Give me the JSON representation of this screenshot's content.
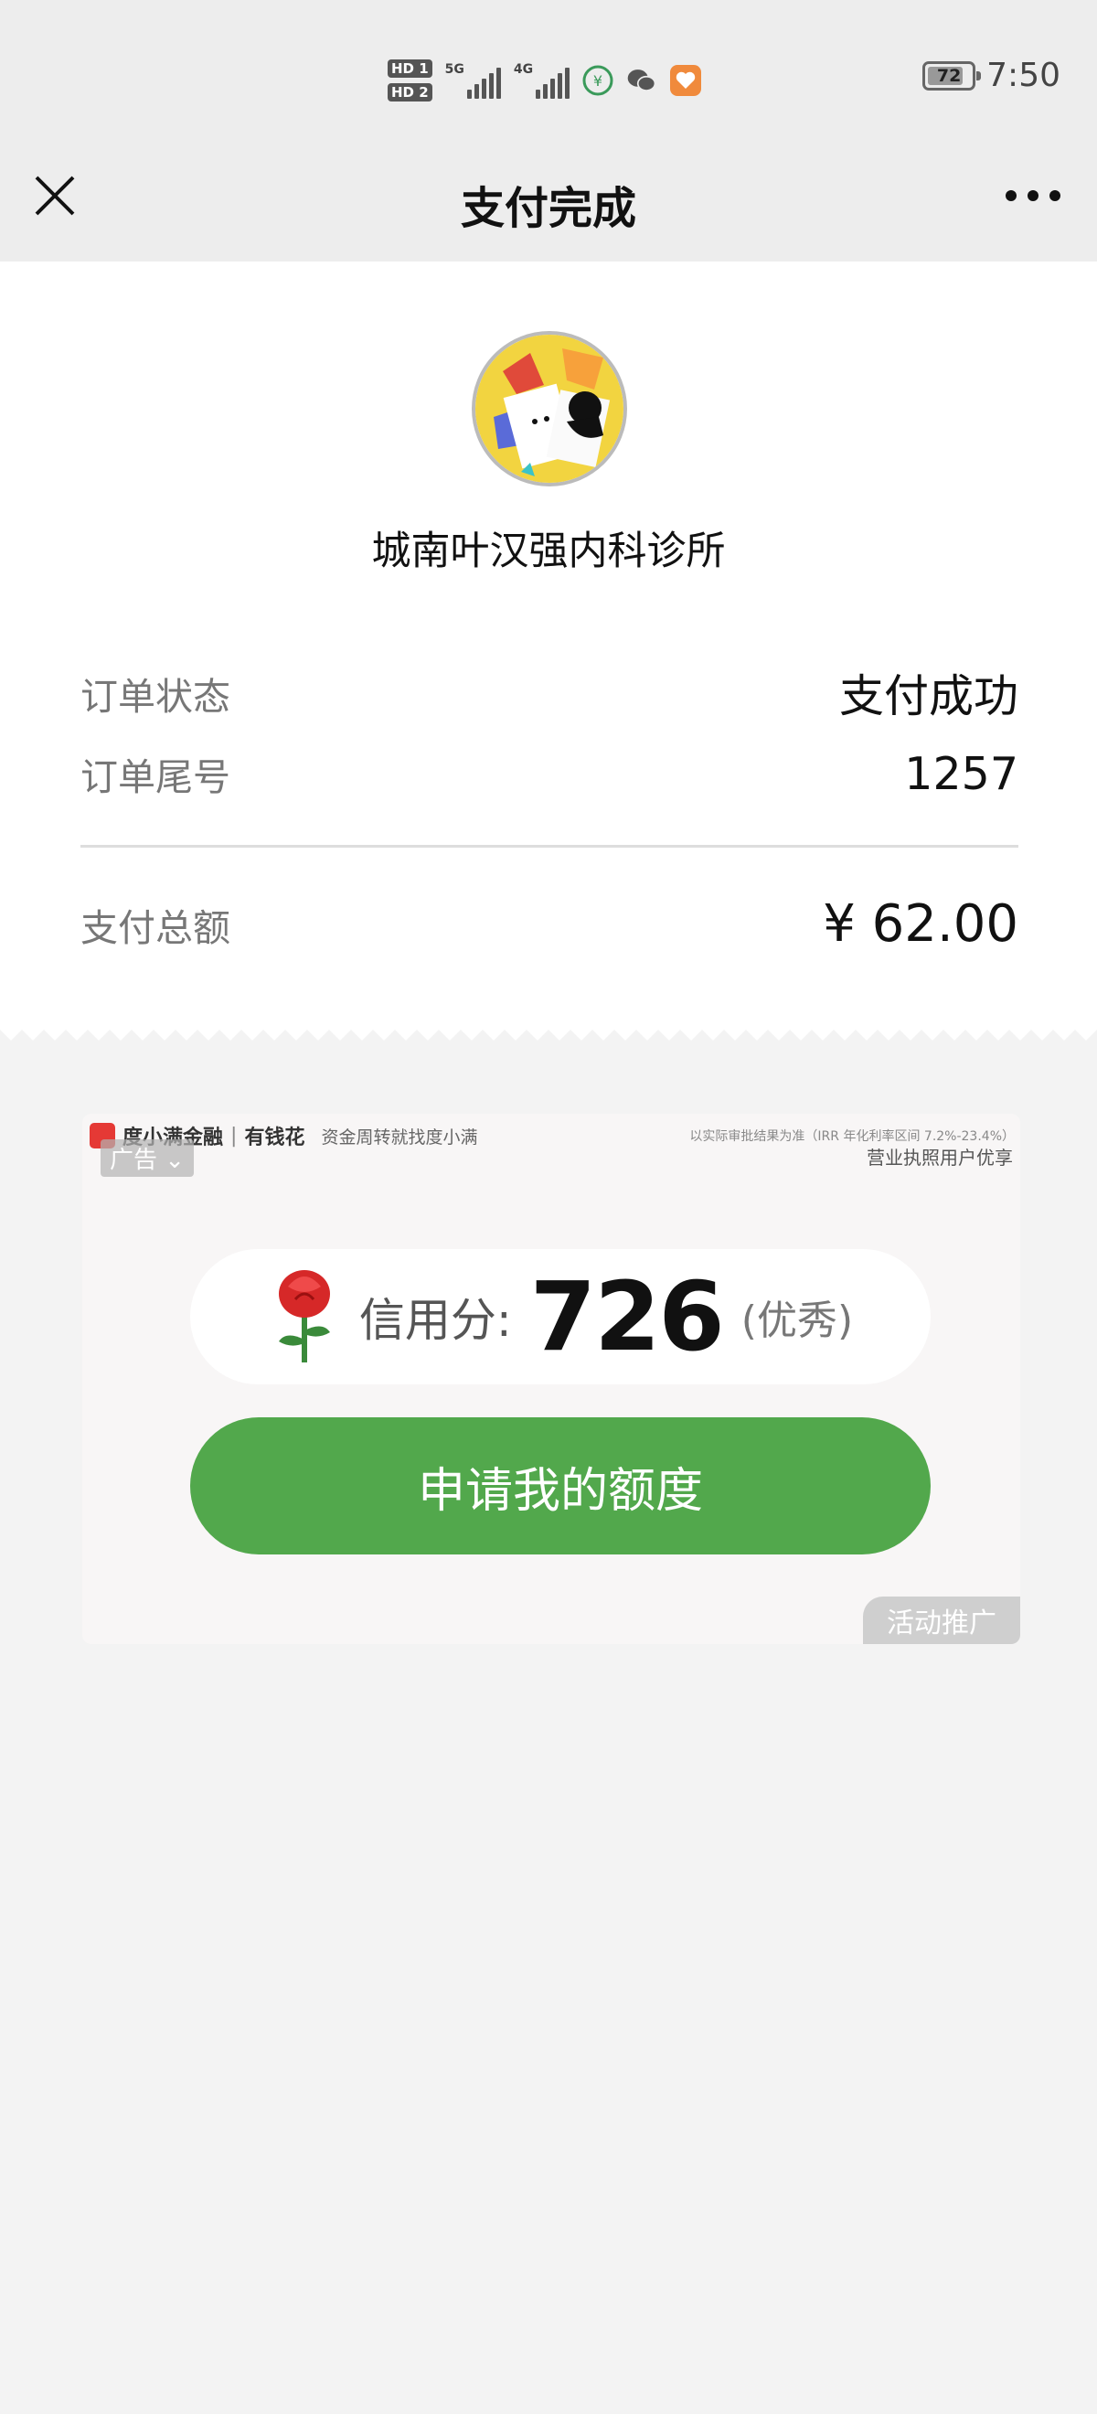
{
  "status_bar": {
    "sim1": "HD 1",
    "sim2": "HD 2",
    "net1": "5G",
    "net2": "4G",
    "battery": "72",
    "time": "7:50"
  },
  "nav": {
    "title": "支付完成"
  },
  "receipt": {
    "merchant_name": "城南叶汉强内科诊所",
    "order_status_label": "订单状态",
    "order_status_value": "支付成功",
    "order_tail_label": "订单尾号",
    "order_tail_value": "1257",
    "total_label": "支付总额",
    "total_value": "¥ 62.00"
  },
  "ad": {
    "tag": "广告",
    "brand": "度小满金融",
    "brand_separator": "|",
    "brand2": "有钱花",
    "slogan": "资金周转就找度小满",
    "disclaimer": "以实际审批结果为准（IRR 年化利率区间 7.2%-23.4%）",
    "subline": "营业执照用户优享",
    "score_label": "信用分:",
    "score_value": "726",
    "score_rating": "(优秀)",
    "apply_button": "申请我的额度",
    "promo_tag": "活动推广"
  },
  "colors": {
    "accent_green": "#52a84c",
    "page_bg": "#f3f3f3",
    "nav_bg": "#ededed"
  }
}
